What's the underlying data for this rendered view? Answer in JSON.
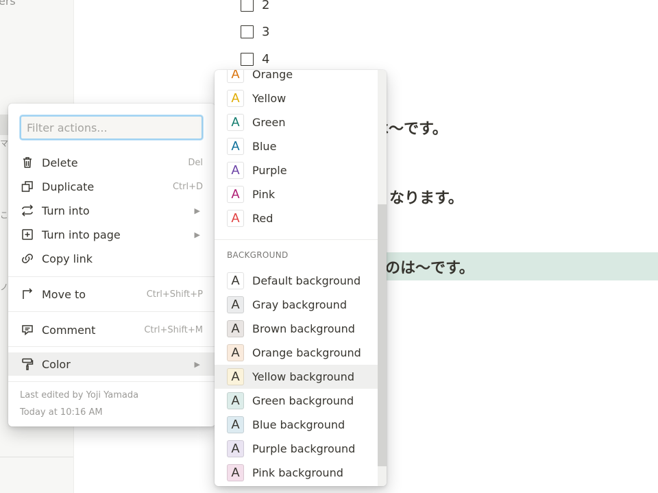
{
  "sidebar": {
    "fragment_text": "ers",
    "marks": [
      "マ",
      "こ",
      "ノ"
    ]
  },
  "checklist": {
    "items": [
      {
        "label": "2",
        "checked": false
      },
      {
        "label": "3",
        "checked": false
      },
      {
        "label": "4",
        "checked": false
      }
    ]
  },
  "content": {
    "heading_1": "は〜です。",
    "heading_2": "くなります。",
    "heading_3": "いのは〜です。",
    "highlight_color": "#d9e9e2"
  },
  "context_menu": {
    "filter_placeholder": "Filter actions...",
    "items": [
      {
        "icon": "trash-icon",
        "label": "Delete",
        "shortcut": "Del"
      },
      {
        "icon": "duplicate-icon",
        "label": "Duplicate",
        "shortcut": "Ctrl+D"
      },
      {
        "icon": "turn-into-icon",
        "label": "Turn into",
        "submenu_arrow": "▶"
      },
      {
        "icon": "plus-square-icon",
        "label": "Turn into page",
        "submenu_arrow": "▶"
      },
      {
        "icon": "link-icon",
        "label": "Copy link"
      },
      {
        "icon": "move-arrow-icon",
        "label": "Move to",
        "shortcut": "Ctrl+Shift+P"
      },
      {
        "icon": "comment-icon",
        "label": "Comment",
        "shortcut": "Ctrl+Shift+M"
      },
      {
        "icon": "paint-roller-icon",
        "label": "Color",
        "submenu_arrow": "▶",
        "active": true
      }
    ],
    "footer": {
      "last_edited_by": "Last edited by Yoji Yamada",
      "last_edited_time": "Today at 10:16 AM"
    }
  },
  "color_menu": {
    "text_colors": [
      {
        "label": "Orange",
        "color": "#d9730d"
      },
      {
        "label": "Yellow",
        "color": "#dfab01"
      },
      {
        "label": "Green",
        "color": "#0f7b6c"
      },
      {
        "label": "Blue",
        "color": "#0b6e99"
      },
      {
        "label": "Purple",
        "color": "#6940a5"
      },
      {
        "label": "Pink",
        "color": "#ad1a72"
      },
      {
        "label": "Red",
        "color": "#e03e3e"
      }
    ],
    "background_header": "BACKGROUND",
    "background_colors": [
      {
        "label": "Default background",
        "color": "#ffffff"
      },
      {
        "label": "Gray background",
        "color": "#ebeced"
      },
      {
        "label": "Brown background",
        "color": "#e9e5e3"
      },
      {
        "label": "Orange background",
        "color": "#faebdd"
      },
      {
        "label": "Yellow background",
        "color": "#fbf3db",
        "active": true
      },
      {
        "label": "Green background",
        "color": "#ddedea"
      },
      {
        "label": "Blue background",
        "color": "#ddebf1"
      },
      {
        "label": "Purple background",
        "color": "#eae4f2"
      },
      {
        "label": "Pink background",
        "color": "#f4dfeb"
      }
    ],
    "swatch_glyph": "A"
  }
}
